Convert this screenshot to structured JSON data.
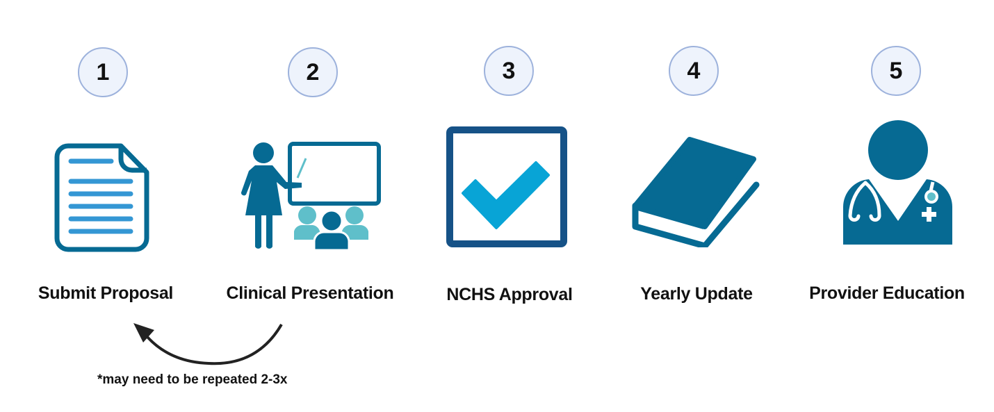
{
  "steps": [
    {
      "number": "1",
      "label": "Submit Proposal",
      "icon": "document-icon"
    },
    {
      "number": "2",
      "label": "Clinical Presentation",
      "icon": "presentation-icon"
    },
    {
      "number": "3",
      "label": "NCHS Approval",
      "icon": "checkbox-icon"
    },
    {
      "number": "4",
      "label": "Yearly Update",
      "icon": "book-icon"
    },
    {
      "number": "5",
      "label": "Provider Education",
      "icon": "doctor-icon"
    }
  ],
  "loop_note": "*may need to be repeated 2-3x",
  "colors": {
    "primary": "#066a93",
    "secondary": "#3497d4",
    "accent_teal": "#5fbfca",
    "check_frame": "#165287",
    "check_mark": "#08a4d6",
    "circle_fill": "#eef3fc",
    "circle_border": "#9db2dc"
  }
}
